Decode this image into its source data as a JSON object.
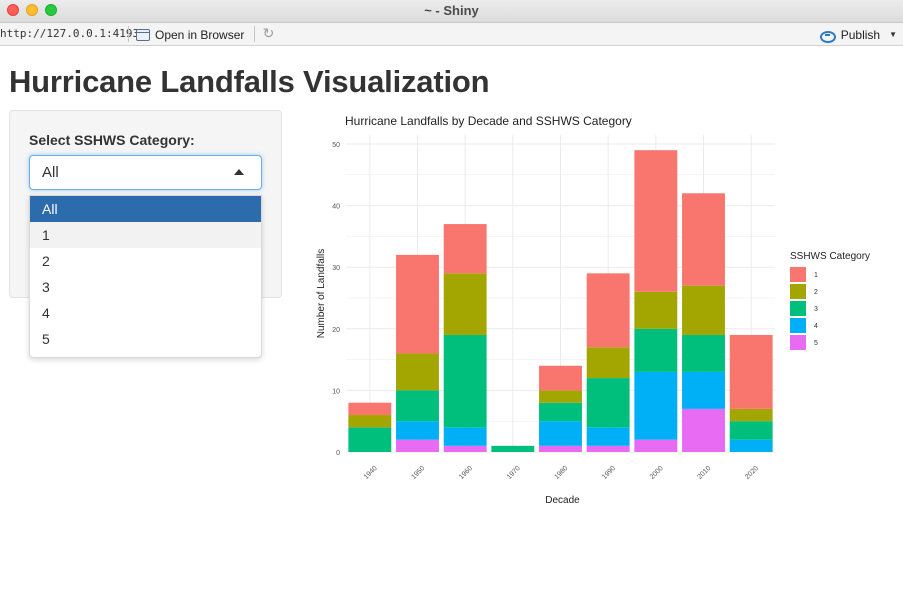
{
  "window": {
    "title": "~ - Shiny"
  },
  "toolbar": {
    "url": "http://127.0.0.1:4193",
    "open_in_browser": "Open in Browser",
    "publish": "Publish"
  },
  "page": {
    "title": "Hurricane Landfalls Visualization"
  },
  "sidebar": {
    "label": "Select SSHWS Category:",
    "select_value": "All",
    "options": [
      "All",
      "1",
      "2",
      "3",
      "4",
      "5"
    ],
    "selected_option": "All",
    "hover_option": "1"
  },
  "colors": {
    "cat1": "#f8766d",
    "cat2": "#a3a500",
    "cat3": "#00bf7d",
    "cat4": "#00b0f6",
    "cat5": "#e76bf3",
    "select_highlight": "#2c6cad"
  },
  "chart_data": {
    "type": "bar",
    "stacked": true,
    "title": "Hurricane Landfalls by Decade and SSHWS Category",
    "xlabel": "Decade",
    "ylabel": "Number of Landfalls",
    "ylim": [
      0,
      50
    ],
    "yticks": [
      0,
      10,
      20,
      30,
      40,
      50
    ],
    "grid": true,
    "legend_title": "SSHWS Category",
    "legend_position": "right",
    "categories": [
      "1940",
      "1950",
      "1960",
      "1970",
      "1980",
      "1990",
      "2000",
      "2010",
      "2020"
    ],
    "series": [
      {
        "name": "1",
        "values": [
          2,
          16,
          8,
          0,
          4,
          12,
          23,
          15,
          12
        ]
      },
      {
        "name": "2",
        "values": [
          2,
          6,
          10,
          0,
          2,
          5,
          6,
          8,
          2
        ]
      },
      {
        "name": "3",
        "values": [
          4,
          5,
          15,
          1,
          3,
          8,
          7,
          6,
          3
        ]
      },
      {
        "name": "4",
        "values": [
          0,
          3,
          3,
          0,
          4,
          3,
          11,
          6,
          2
        ]
      },
      {
        "name": "5",
        "values": [
          0,
          2,
          1,
          0,
          1,
          1,
          2,
          7,
          0
        ]
      }
    ]
  }
}
